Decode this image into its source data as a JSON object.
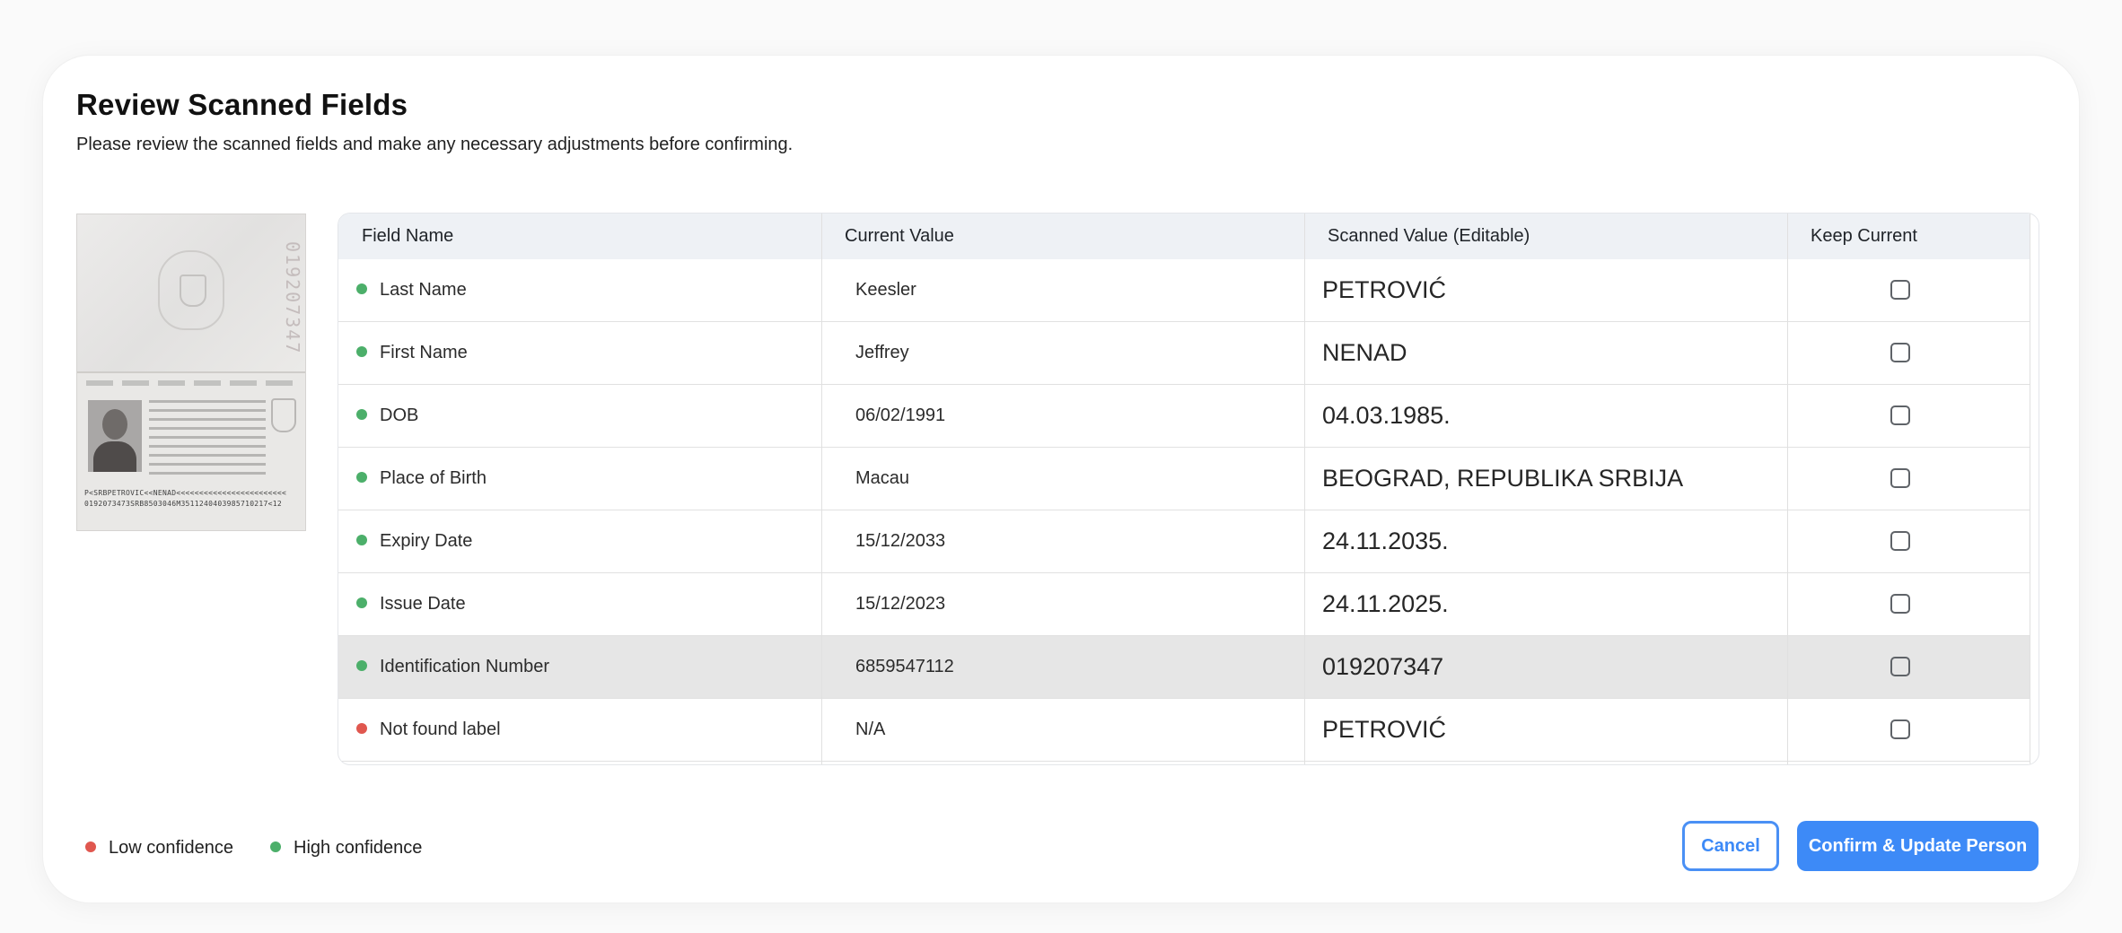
{
  "dialog": {
    "title": "Review Scanned Fields",
    "subtitle": "Please review the scanned fields and make any necessary adjustments before confirming."
  },
  "passport_image": {
    "vertical_number": "019207347",
    "mrz_line1": "P<SRBPETROVIC<<NENAD<<<<<<<<<<<<<<<<<<<<<<<<",
    "mrz_line2": "0192073473SRB8503046M3511240403985710217<12"
  },
  "table": {
    "headers": {
      "field_name": "Field Name",
      "current_value": "Current Value",
      "scanned_value": "Scanned Value (Editable)",
      "keep_current": "Keep Current"
    },
    "rows": [
      {
        "field": "Last Name",
        "current": "Keesler",
        "scanned": "PETROVIĆ",
        "confidence": "high",
        "keep_current": false
      },
      {
        "field": "First Name",
        "current": "Jeffrey",
        "scanned": "NENAD",
        "confidence": "high",
        "keep_current": false
      },
      {
        "field": "DOB",
        "current": "06/02/1991",
        "scanned": "04.03.1985.",
        "confidence": "high",
        "keep_current": false
      },
      {
        "field": "Place of Birth",
        "current": "Macau",
        "scanned": "BEOGRAD, REPUBLIKA SRBIJA",
        "confidence": "high",
        "keep_current": false
      },
      {
        "field": "Expiry Date",
        "current": "15/12/2033",
        "scanned": "24.11.2035.",
        "confidence": "high",
        "keep_current": false
      },
      {
        "field": "Issue Date",
        "current": "15/12/2023",
        "scanned": "24.11.2025.",
        "confidence": "high",
        "keep_current": false
      },
      {
        "field": "Identification Number",
        "current": "6859547112",
        "scanned": "019207347",
        "confidence": "high",
        "keep_current": false,
        "hovered": true
      },
      {
        "field": "Not found label",
        "current": "N/A",
        "scanned": "PETROVIĆ",
        "confidence": "low",
        "keep_current": false
      }
    ]
  },
  "legend": {
    "low": "Low confidence",
    "high": "High confidence"
  },
  "buttons": {
    "cancel": "Cancel",
    "confirm": "Confirm & Update Person"
  },
  "colors": {
    "high_confidence": "#4caf6a",
    "low_confidence": "#e0574f",
    "accent": "#3d8af7",
    "header_bg": "#eef1f5",
    "hover_row": "#e6e6e6"
  }
}
